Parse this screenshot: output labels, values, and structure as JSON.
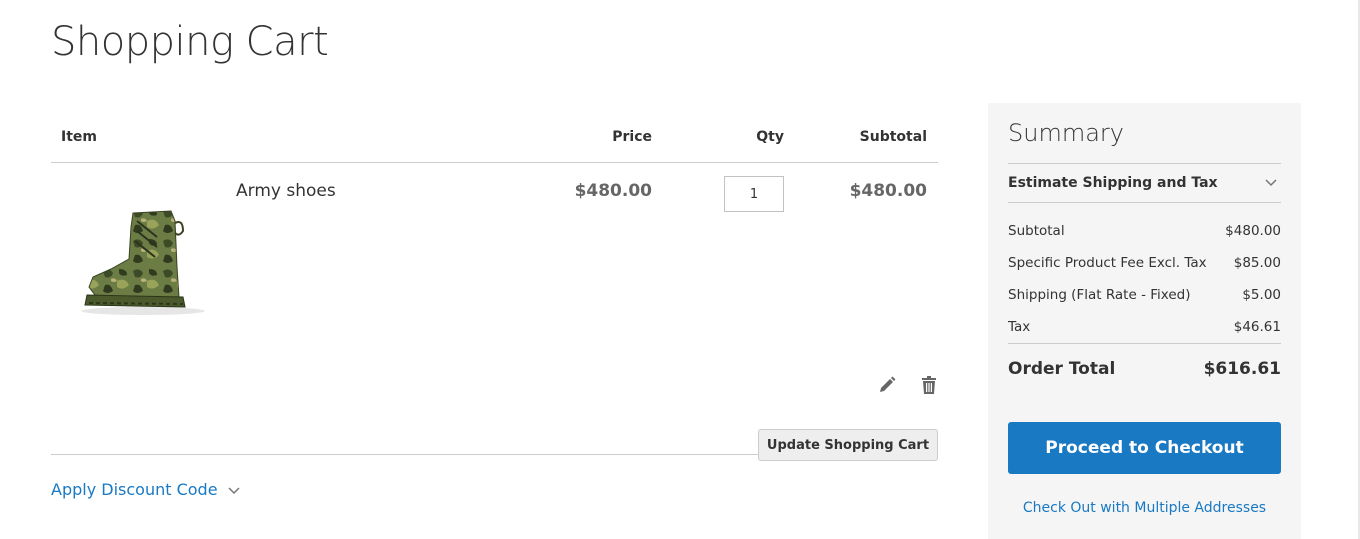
{
  "page": {
    "title": "Shopping Cart"
  },
  "table": {
    "headers": {
      "item": "Item",
      "price": "Price",
      "qty": "Qty",
      "subtotal": "Subtotal"
    },
    "items": [
      {
        "name": "Army shoes",
        "price": "$480.00",
        "qty": "1",
        "subtotal": "$480.00",
        "image_icon": "army-boot-image"
      }
    ]
  },
  "actions": {
    "update_cart": "Update Shopping Cart",
    "apply_discount": "Apply Discount Code"
  },
  "summary": {
    "title": "Summary",
    "estimate_label": "Estimate Shipping and Tax",
    "rows": [
      {
        "label": "Subtotal",
        "value": "$480.00"
      },
      {
        "label": "Specific Product Fee Excl. Tax",
        "value": "$85.00"
      },
      {
        "label": "Shipping (Flat Rate - Fixed)",
        "value": "$5.00"
      },
      {
        "label": "Tax",
        "value": "$46.61"
      }
    ],
    "order_total": {
      "label": "Order Total",
      "value": "$616.61"
    },
    "checkout_label": "Proceed to Checkout",
    "multi_address_label": "Check Out with Multiple Addresses"
  },
  "colors": {
    "accent": "#1979c3",
    "summary_bg": "#f5f5f5"
  }
}
